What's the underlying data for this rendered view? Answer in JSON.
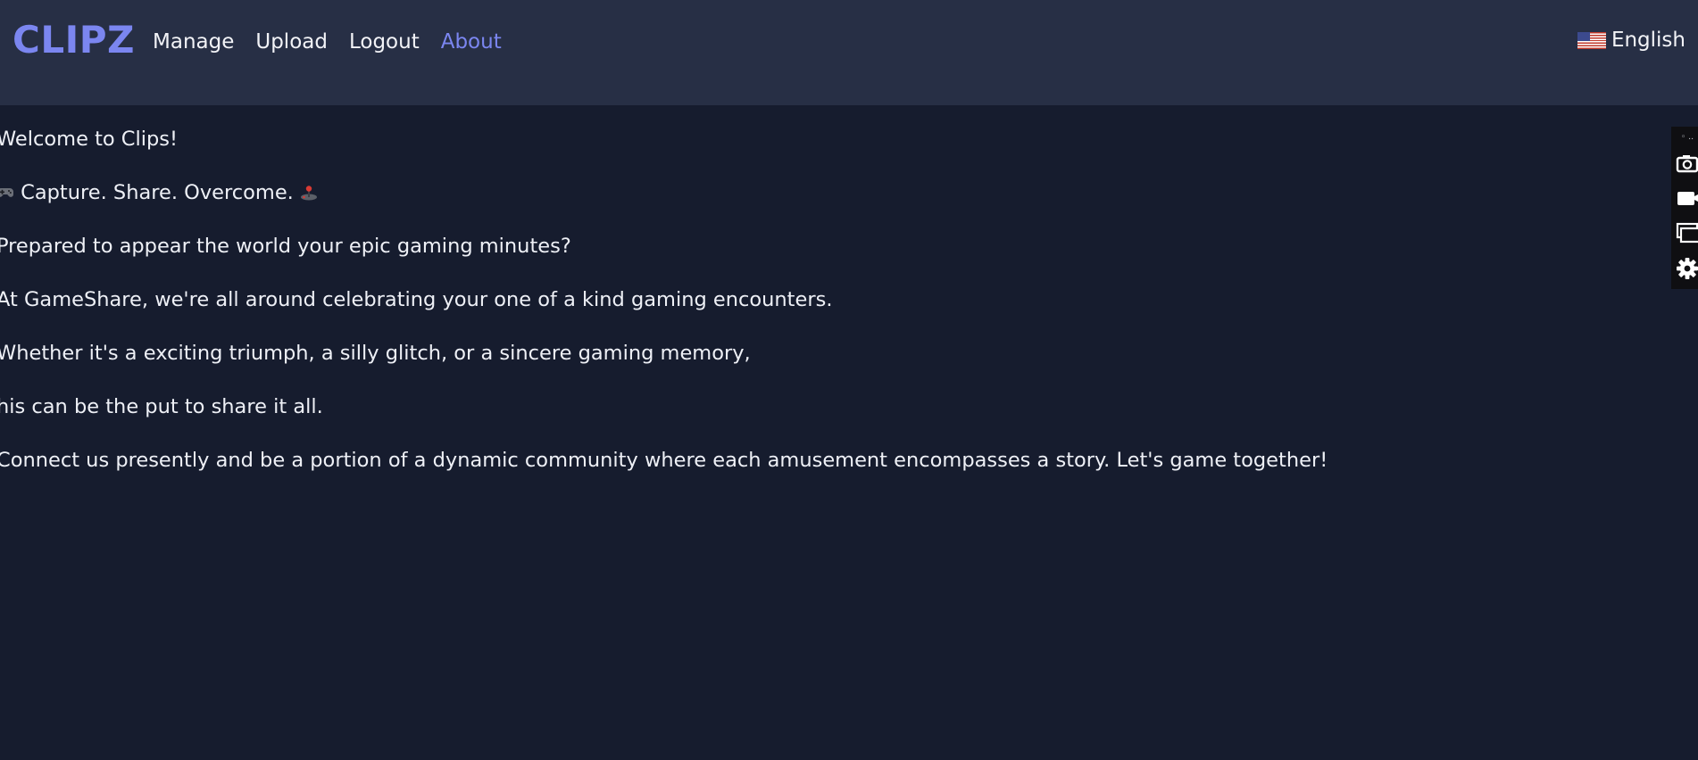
{
  "header": {
    "logo": "CLIPZ",
    "nav": [
      {
        "label": "Manage",
        "active": false
      },
      {
        "label": "Upload",
        "active": false
      },
      {
        "label": "Logout",
        "active": false
      },
      {
        "label": "About",
        "active": true
      }
    ],
    "language": {
      "label": "English",
      "flag_icon": "us-flag-icon"
    }
  },
  "about": {
    "welcome": "Welcome to Clips!",
    "tagline": "Capture. Share. Overcome.",
    "tagline_icons": [
      "gamepad-icon",
      "joystick-icon"
    ],
    "question": "Prepared to appear the world your epic gaming minutes?",
    "intro": "At GameShare, we're all around celebrating your one of a kind gaming encounters.",
    "whether": "Whether it's a exciting triumph, a silly glitch, or a sincere gaming memory,",
    "place": "his can be the put to share it all.",
    "connect": "Connect us presently and be a portion of a dynamic community where each amusement encompasses a story. Let's game together!"
  },
  "side_toolbar": {
    "icons": [
      "drag-handle-icon",
      "camera-icon",
      "video-camera-icon",
      "window-icon",
      "gear-icon"
    ]
  },
  "colors": {
    "background": "#161c2e",
    "header": "#272f45",
    "accent": "#7b86f0",
    "text": "#eef0f6"
  }
}
